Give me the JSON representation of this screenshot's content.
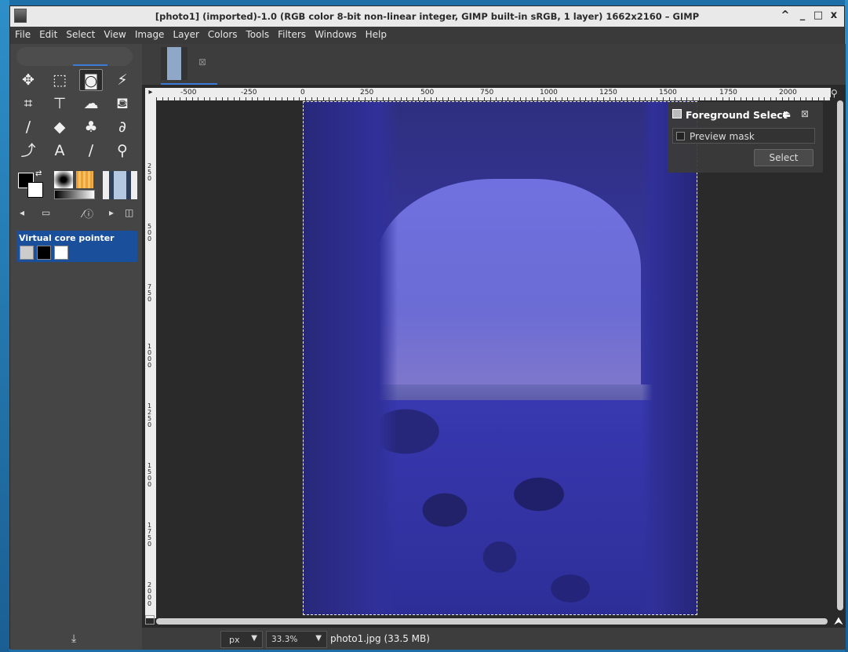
{
  "window": {
    "title": "[photo1] (imported)-1.0 (RGB color 8-bit non-linear integer, GIMP built-in sRGB, 1 layer) 1662x2160 – GIMP",
    "controls": [
      "^",
      "_",
      "□",
      "x"
    ]
  },
  "menubar": {
    "items": [
      "File",
      "Edit",
      "Select",
      "View",
      "Image",
      "Layer",
      "Colors",
      "Tools",
      "Filters",
      "Windows",
      "Help"
    ]
  },
  "toolbox": {
    "tools": [
      {
        "name": "move-tool",
        "glyph": "✥"
      },
      {
        "name": "rect-select-tool",
        "glyph": "⬚"
      },
      {
        "name": "foreground-select-tool",
        "glyph": "◙",
        "active": true
      },
      {
        "name": "fuzzy-select-tool",
        "glyph": "⚡"
      },
      {
        "name": "crop-tool",
        "glyph": "⌗"
      },
      {
        "name": "transform-tool",
        "glyph": "⊤"
      },
      {
        "name": "warp-tool",
        "glyph": "☁"
      },
      {
        "name": "bucket-fill-tool",
        "glyph": "⛾"
      },
      {
        "name": "paintbrush-tool",
        "glyph": "∕"
      },
      {
        "name": "eraser-tool",
        "glyph": "◆"
      },
      {
        "name": "clone-tool",
        "glyph": "♣"
      },
      {
        "name": "smudge-tool",
        "glyph": "∂"
      },
      {
        "name": "paths-tool",
        "glyph": "⤴"
      },
      {
        "name": "text-tool",
        "glyph": "A"
      },
      {
        "name": "color-picker-tool",
        "glyph": "∕"
      },
      {
        "name": "zoom-tool",
        "glyph": "⚲"
      }
    ],
    "device_status": {
      "label": "Virtual core pointer"
    }
  },
  "canvas": {
    "ruler_top_labels": [
      "-500",
      "-250",
      "0",
      "250",
      "500",
      "750",
      "1000",
      "1250",
      "1500",
      "1750",
      "2000"
    ],
    "ruler_left_labels": [
      "2 5 0",
      "5 0 0",
      "7 5 0",
      "1 0 0 0",
      "1 2 5 0",
      "1 5 0 0",
      "1 7 5 0",
      "2 0 0 0"
    ]
  },
  "foreground_select": {
    "title": "Foreground Select",
    "preview_mask_label": "Preview mask",
    "select_button": "Select"
  },
  "statusbar": {
    "unit": "px",
    "zoom": "33.3%",
    "file_info": "photo1.jpg (33.5 MB)"
  }
}
